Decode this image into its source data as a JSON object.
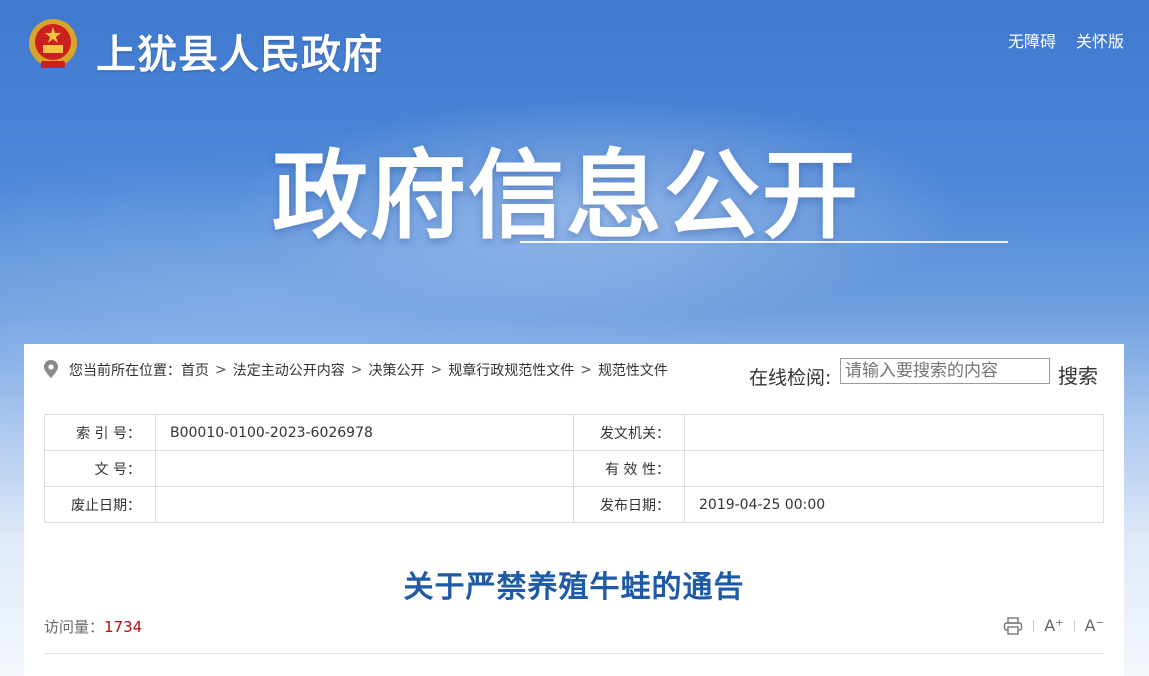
{
  "header": {
    "site_title": "上犹县人民政府",
    "links": [
      "无障碍",
      "关怀版"
    ],
    "hero_title": "政府信息公开"
  },
  "breadcrumb": {
    "prefix": "您当前所在位置：",
    "items": [
      "首页",
      "法定主动公开内容",
      "决策公开",
      "规章行政规范性文件",
      "规范性文件"
    ],
    "separator": ">"
  },
  "search": {
    "label": "在线检阅:",
    "placeholder": "请输入要搜索的内容",
    "button": "搜索"
  },
  "meta_table": {
    "rows": [
      {
        "label1": "索 引 号：",
        "value1": "B00010-0100-2023-6026978",
        "label2": "发文机关：",
        "value2": ""
      },
      {
        "label1": "文 号：",
        "value1": "",
        "label2": "有 效 性：",
        "value2": ""
      },
      {
        "label1": "废止日期：",
        "value1": "",
        "label2": "发布日期：",
        "value2": "2019-04-25 00:00"
      }
    ]
  },
  "article": {
    "title": "关于严禁养殖牛蛙的通告",
    "visits_label": "访问量：",
    "visits_count": "1734",
    "tools": {
      "print_icon": "print-icon",
      "font_larger": "A⁺",
      "font_smaller": "A⁻"
    }
  },
  "colors": {
    "banner_top": "#3f79cf",
    "title_blue": "#1e5aa5",
    "visits_red": "#b01010"
  }
}
